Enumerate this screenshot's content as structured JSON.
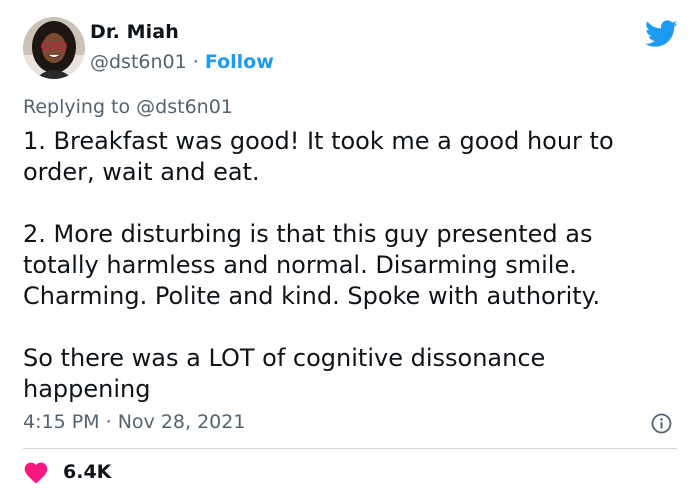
{
  "author": {
    "name": "Dr. Miah",
    "handle": "@dst6n01",
    "separator": "·",
    "follow_label": "Follow"
  },
  "reply": {
    "prefix": "Replying to",
    "mention": "@dst6n01"
  },
  "tweet": {
    "paragraphs": [
      "1. Breakfast was good! It took me a good hour to order, wait and eat.",
      "2. More disturbing is that this guy presented as totally harmless and normal. Disarming smile. Charming. Polite and kind. Spoke with authority.",
      "So there was a LOT of cognitive dissonance happening"
    ]
  },
  "meta": {
    "time": "4:15 PM",
    "separator": "·",
    "date": "Nov 28, 2021"
  },
  "engagement": {
    "likes": "6.4K"
  },
  "icons": {
    "brand": "twitter-bird-icon",
    "info": "info-icon",
    "like": "heart-icon"
  },
  "colors": {
    "accent": "#1d9bf0",
    "like": "#f91880",
    "secondary_text": "#536471",
    "primary_text": "#0f1419"
  }
}
